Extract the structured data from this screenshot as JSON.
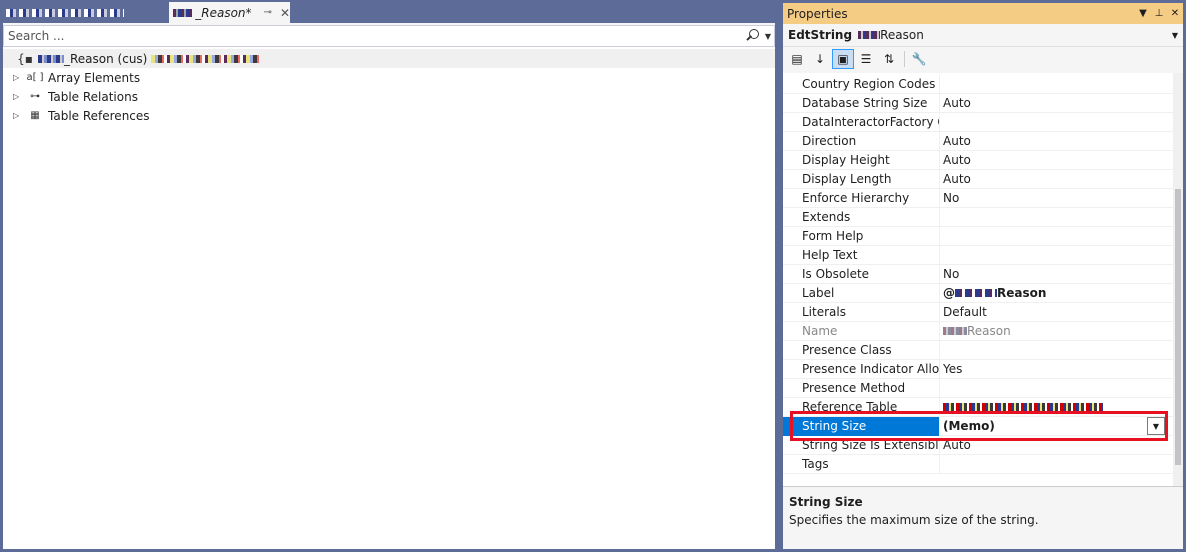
{
  "tabs": {
    "active_label": "_Reason*",
    "pin_glyph": "⊸",
    "close_glyph": "✕"
  },
  "search": {
    "placeholder": "Search ...",
    "value": ""
  },
  "tree": {
    "root_label": "_Reason (cus)",
    "children": [
      {
        "label": "Array Elements",
        "icon": "array-icon"
      },
      {
        "label": "Table Relations",
        "icon": "relations-icon"
      },
      {
        "label": "Table References",
        "icon": "table-icon"
      }
    ]
  },
  "properties": {
    "title": "Properties",
    "object_type": "EdtString",
    "object_name": "Reason",
    "rows": [
      {
        "name": "Country Region Codes",
        "value": ""
      },
      {
        "name": "Database String Size",
        "value": "Auto"
      },
      {
        "name": "DataInteractorFactory Clas",
        "value": ""
      },
      {
        "name": "Direction",
        "value": "Auto"
      },
      {
        "name": "Display Height",
        "value": "Auto"
      },
      {
        "name": "Display Length",
        "value": "Auto"
      },
      {
        "name": "Enforce Hierarchy",
        "value": "No"
      },
      {
        "name": "Extends",
        "value": ""
      },
      {
        "name": "Form Help",
        "value": ""
      },
      {
        "name": "Help Text",
        "value": ""
      },
      {
        "name": "Is Obsolete",
        "value": "No"
      },
      {
        "name": "Label",
        "value": "Reason",
        "prefix": "@"
      },
      {
        "name": "Literals",
        "value": "Default"
      },
      {
        "name": "Name",
        "value": "Reason"
      },
      {
        "name": "Presence Class",
        "value": ""
      },
      {
        "name": "Presence Indicator Allowe",
        "value": "Yes"
      },
      {
        "name": "Presence Method",
        "value": ""
      },
      {
        "name": "Reference Table",
        "value": ""
      },
      {
        "name": "String Size",
        "value": "(Memo)"
      },
      {
        "name": "String Size Is Extensible",
        "value": "Auto"
      },
      {
        "name": "Tags",
        "value": ""
      }
    ],
    "description": {
      "title": "String Size",
      "text": "Specifies the maximum size of the string."
    }
  },
  "colors": {
    "frame": "#5d6b99",
    "title_active": "#f5cc84",
    "selection": "#0078d7",
    "highlight": "#e81123"
  }
}
